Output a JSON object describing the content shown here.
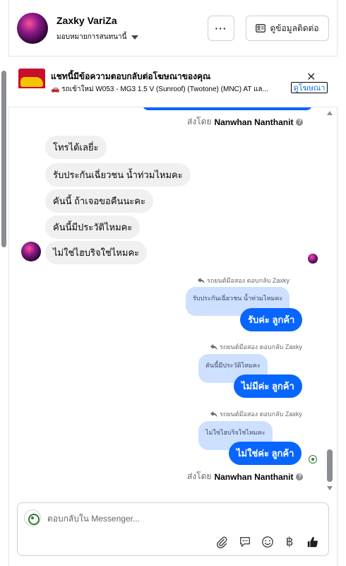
{
  "header": {
    "name": "Zaxky VariZa",
    "subtitle": "มอบหมายการสนทนานี้",
    "more_label": "···",
    "contact_label": "ดูข้อมูลติดต่อ"
  },
  "ad": {
    "title": "แชทนี้มีข้อความตอบกลับต่อโฆษณาของคุณ",
    "subtitle": "🚗 รถเข้าใหม่ W053 - MG3 1.5 V (Sunroof) (Twotone) (MNC) AT แล...",
    "link_label": "ดูโฆษณา"
  },
  "sent_by_top": {
    "prefix": "ส่งโดย",
    "name": "Nanwhan Nanthanit"
  },
  "incoming": [
    "โทรได้เลยี่ะ",
    "รับประกันเฉี่ยวชน น้ำท่วมไหมคะ",
    "คันนี้ ถ้าเจอขอคืนนะคะ",
    "คันนี้มีประวัติไหมคะ",
    "ไม่ใช่ไฮบริจใช่ไหมคะ"
  ],
  "replies": [
    {
      "label": "รถยนต์มือสอง ตอบกลับ Zaxky",
      "quote": "รับประกันเฉี่ยวชน น้ำท่วมไหมคะ",
      "text": "รับค่ะ ลูกค้า"
    },
    {
      "label": "รถยนต์มือสอง ตอบกลับ Zaxky",
      "quote": "คันนี้มีประวัติไหมคะ",
      "text": "ไม่มีค่ะ ลูกค้า"
    },
    {
      "label": "รถยนต์มือสอง ตอบกลับ Zaxky",
      "quote": "ไม่ใช่ไฮบริจใช่ไหมคะ",
      "text": "ไม่ใช่ค่ะ ลูกค้า"
    }
  ],
  "sent_by_bottom": {
    "prefix": "ส่งโดย",
    "name": "Nanwhan Nanthanit"
  },
  "composer": {
    "placeholder": "ตอบกลับใน Messenger...",
    "currency_symbol": "฿"
  },
  "colors": {
    "brand_blue": "#0866ff",
    "quote_blue": "#cde0ff",
    "incoming_gray": "#f0f0f0"
  }
}
